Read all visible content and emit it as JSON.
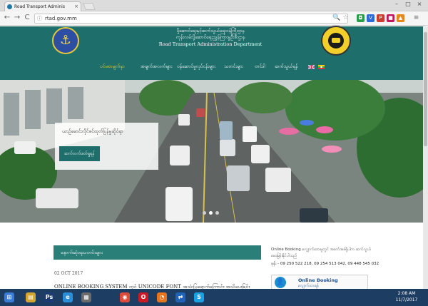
{
  "browser": {
    "tab_title": "Road Transport Adminis",
    "tab_close": "×",
    "window_controls": [
      "–",
      "□",
      "×"
    ],
    "nav_back": "←",
    "nav_forward": "→",
    "nav_reload": "C",
    "url": "rtad.gov.mm",
    "extensions": [
      {
        "icon": "search-icon",
        "glyph": "🔍",
        "color": "#888888"
      },
      {
        "icon": "star-icon",
        "glyph": "☆",
        "color": "#888888"
      },
      {
        "icon": "ext-icon",
        "glyph": "◘",
        "color": "#2a9d4b"
      },
      {
        "icon": "ext-icon",
        "glyph": "V",
        "color": "#2b6cd6"
      },
      {
        "icon": "ext-icon",
        "glyph": "P",
        "color": "#d03a2f"
      },
      {
        "icon": "ext-icon",
        "glyph": "■",
        "color": "#c2185b"
      },
      {
        "icon": "ext-icon",
        "glyph": "▲",
        "color": "#e8861b"
      },
      {
        "icon": "menu-icon",
        "glyph": "≡",
        "color": "#666666"
      }
    ]
  },
  "site": {
    "title_my_line1": "ပို့ဆောင်ရေးနှင့်ဆက်သွယ်ရေးဝန်ကြီးဌာန",
    "title_my_line2": "ကုန်းလမ်းပို့ဆောင်ရေးညွှန်ကြားမှုဦးစီးဌာန",
    "title_en": "Road Transport Administration Department",
    "menu": [
      {
        "label": "ပင်မစာမျက်နှာ",
        "active": true
      },
      {
        "label": "အချက်အလက်များ",
        "active": false
      },
      {
        "label": "ဝန်ဆောင်မှုလုပ်ငန်းများ",
        "active": false
      },
      {
        "label": "သတင်းများ",
        "active": false
      },
      {
        "label": "တင်ဒါ",
        "active": false
      },
      {
        "label": "ဆက်သွယ်ရန်",
        "active": false
      }
    ]
  },
  "hero": {
    "caption": "ယာဉ်မောင်းလိုင်စင်ထုတ်ပြန်မှုဆိုင်ရာ",
    "button_label": "ဆက်လက်ဖတ်ရှုရန်",
    "slides": 3,
    "active_slide": 1
  },
  "news": {
    "heading": "နောက်ဆုံးရသတင်းများ",
    "date": "02 OCT 2017",
    "title": "ONLINE BOOKING SYSTEM တွင် UNICODE FONT အသုံးပြုရောက်ကြောင်း အသိပေးခြင်း"
  },
  "sidebar": {
    "info": "Online Booking လျှောက်ထားမှုတွင် အခက်အခဲရှိပါက ဆက်သွယ်မေးမြန်းနိုင်ပါသည်",
    "phone": "ဖုန်း - 09 250 522 218, 09 254 513 042, 09 448 545 032",
    "booking_title": "Online Booking",
    "booking_sub": "လျှောက်ထားရန်"
  },
  "taskbar": {
    "items": [
      {
        "icon": "windows-start-icon",
        "glyph": "⊞",
        "color": "#3a7bd5"
      },
      {
        "icon": "file-explorer-icon",
        "glyph": "▤",
        "color": "#d4a52c"
      },
      {
        "icon": "photoshop-icon",
        "glyph": "Ps",
        "color": "#1f3b74"
      },
      {
        "icon": "internet-explorer-icon",
        "glyph": "e",
        "color": "#2c8ed6"
      },
      {
        "icon": "notepad-icon",
        "glyph": "▦",
        "color": "#6b6b6b"
      },
      {
        "icon": "chrome-icon",
        "glyph": "◉",
        "color": "#e04a3a"
      },
      {
        "icon": "opera-icon",
        "glyph": "O",
        "color": "#cc1a23"
      },
      {
        "icon": "firefox-icon",
        "glyph": "◔",
        "color": "#e8731a"
      },
      {
        "icon": "teamviewer-icon",
        "glyph": "⇄",
        "color": "#1f62b8"
      },
      {
        "icon": "skype-icon",
        "glyph": "S",
        "color": "#1ba1e2"
      }
    ],
    "time": "2:08 AM",
    "date": "11/7/2017"
  },
  "colors": {
    "brand_teal": "#1e6f6c",
    "menu_active": "#f3d33c"
  }
}
